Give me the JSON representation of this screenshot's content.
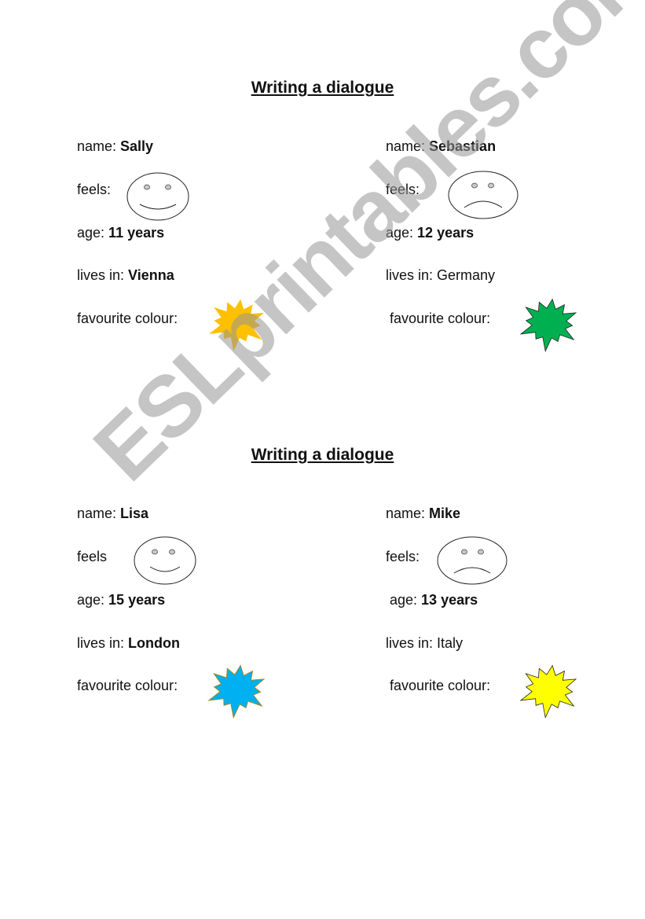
{
  "watermark": "ESLprintables.com",
  "sections": [
    {
      "title": "Writing a dialogue",
      "people": [
        {
          "name_label": "name: ",
          "name": "Sally",
          "feels_label": "feels:",
          "mood": "happy",
          "age_label": "age: ",
          "age": "11 years",
          "lives_label": "lives in: ",
          "lives": "Vienna",
          "lives_bold": true,
          "colour_label": "favourite colour:",
          "colour": "#FFC000"
        },
        {
          "name_label": "name: ",
          "name": "Sebastian",
          "feels_label": "feels:",
          "mood": "sad",
          "age_label": "age: ",
          "age": "12 years",
          "lives_label": "lives in: ",
          "lives": "Germany",
          "lives_bold": false,
          "colour_label": "favourite colour:",
          "colour": "#00B050"
        }
      ]
    },
    {
      "title": "Writing a dialogue",
      "people": [
        {
          "name_label": "name: ",
          "name": "Lisa",
          "feels_label": "feels",
          "mood": "happy",
          "age_label": "age: ",
          "age": "15 years",
          "lives_label": "lives in: ",
          "lives": "London",
          "lives_bold": true,
          "colour_label": "favourite colour:",
          "colour": "#00B0F0"
        },
        {
          "name_label": "name: ",
          "name": "Mike",
          "feels_label": "feels:",
          "mood": "sad",
          "age_label": "age: ",
          "age": "13 years",
          "lives_label": "lives in: ",
          "lives": "Italy",
          "lives_bold": false,
          "colour_label": "favourite colour:",
          "colour": "#FFFF00"
        }
      ]
    }
  ]
}
